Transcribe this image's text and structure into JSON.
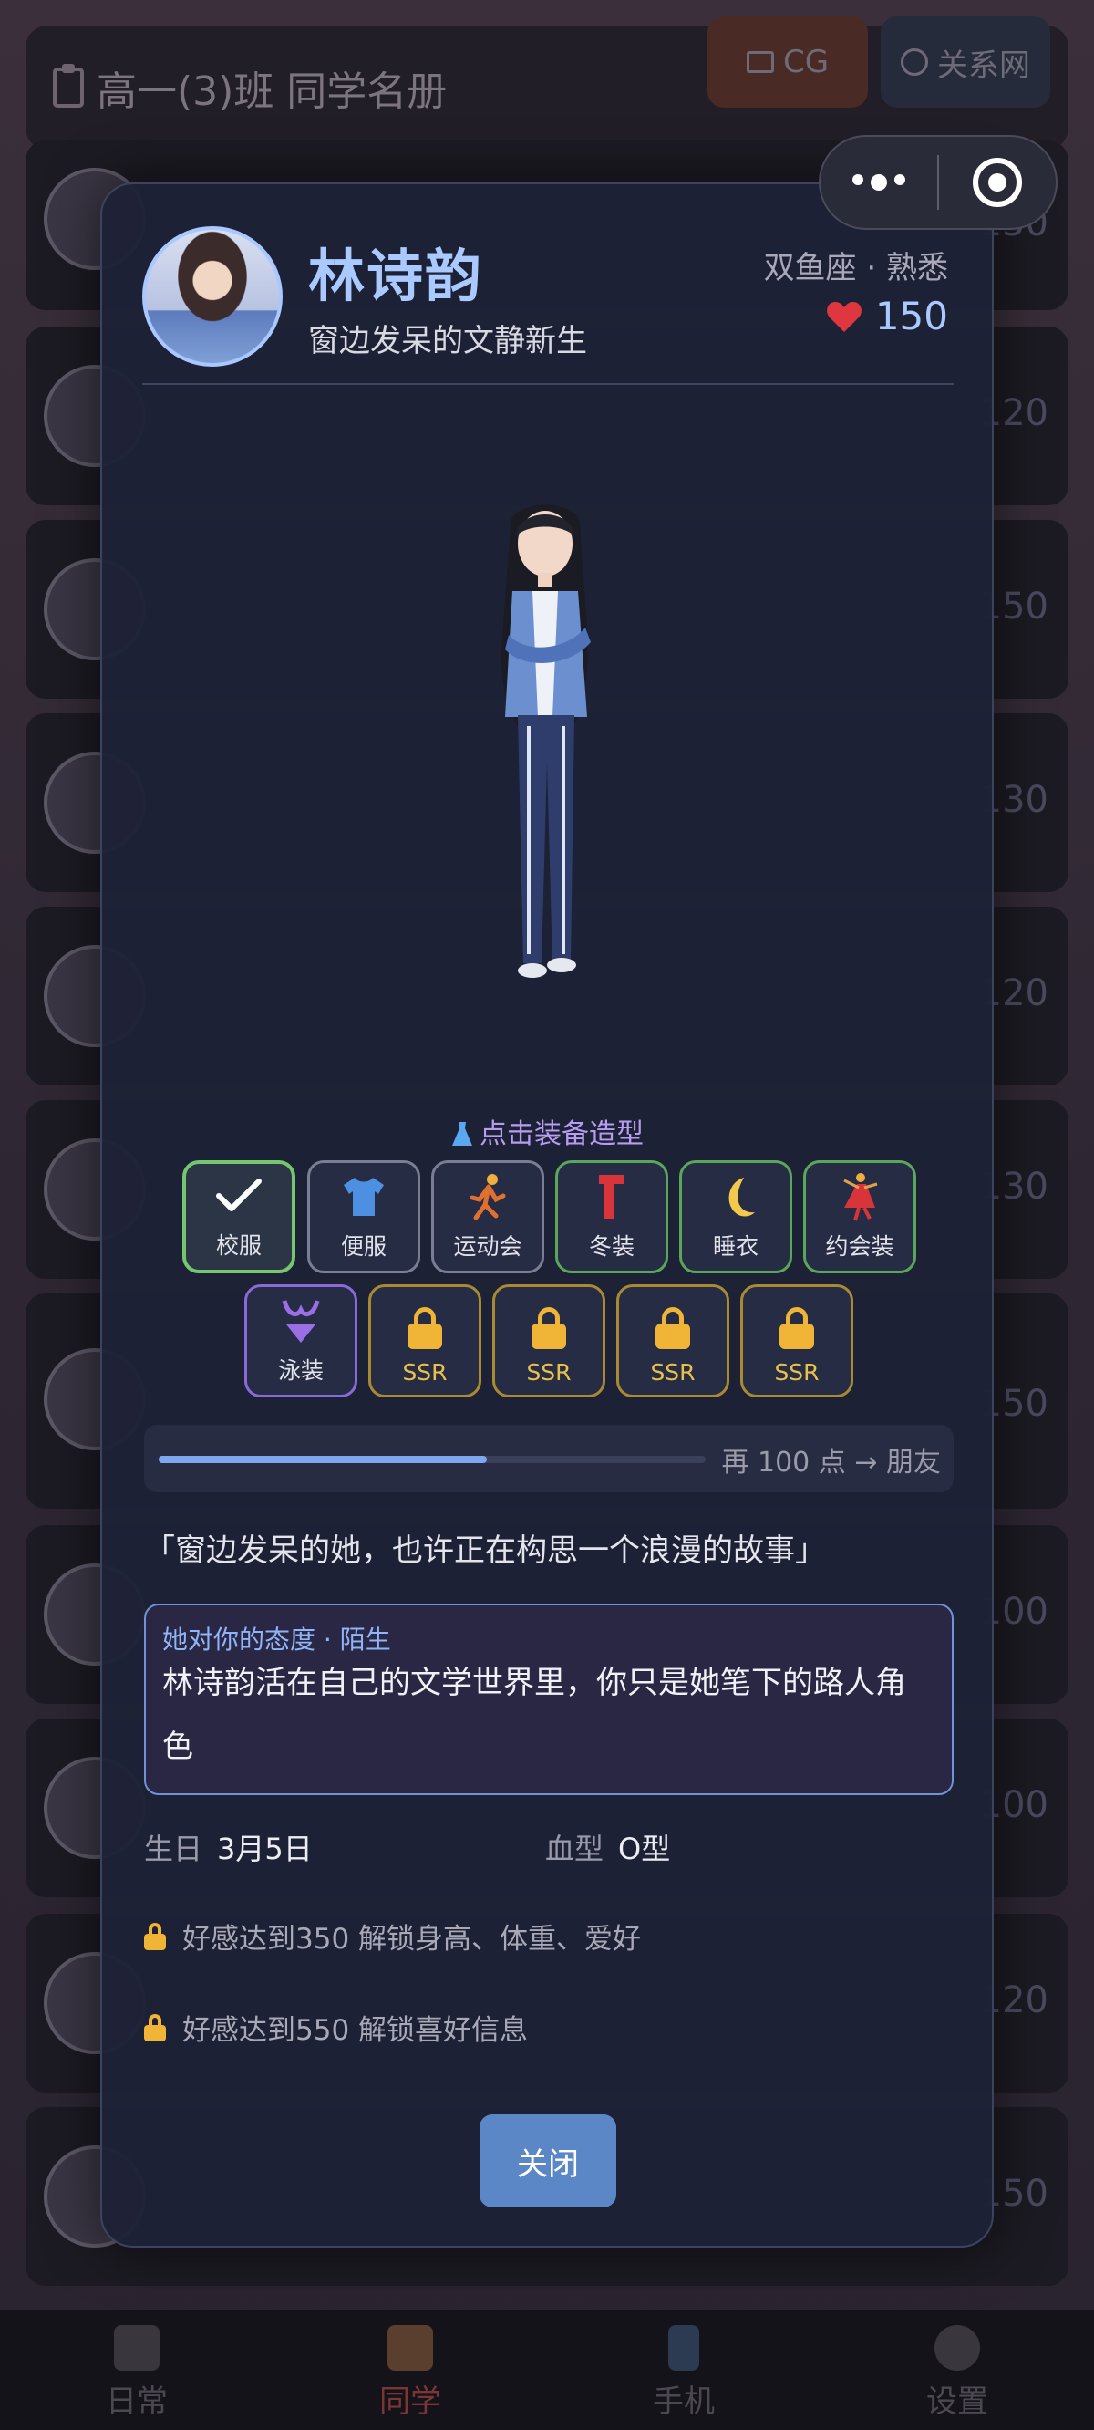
{
  "background": {
    "header_title": "高一(3)班 同学名册",
    "cg_button": "CG",
    "relation_button": "关系网",
    "card_numbers": [
      "150",
      "120",
      "150",
      "130",
      "120",
      "130",
      "150",
      "100",
      "100",
      "120",
      "150"
    ],
    "tabs": [
      "日常",
      "同学",
      "手机",
      "设置"
    ],
    "active_tab": "同学"
  },
  "profile": {
    "name": "林诗韵",
    "subtitle": "窗边发呆的文静新生",
    "meta": "双鱼座 · 熟悉",
    "affection": "150"
  },
  "outfits": {
    "title": "点击装备造型",
    "row1": [
      {
        "label": "校服",
        "state": "selected",
        "icon": "check-icon"
      },
      {
        "label": "便服",
        "state": "available",
        "icon": "tshirt-icon"
      },
      {
        "label": "运动会",
        "state": "available",
        "icon": "runner-icon"
      },
      {
        "label": "冬装",
        "state": "available",
        "icon": "scarf-icon"
      },
      {
        "label": "睡衣",
        "state": "available",
        "icon": "moon-icon"
      },
      {
        "label": "约会装",
        "state": "available",
        "icon": "dancer-icon"
      }
    ],
    "row2": [
      {
        "label": "泳装",
        "state": "available",
        "icon": "bikini-icon"
      },
      {
        "label": "SSR",
        "state": "locked",
        "icon": "lock-icon"
      },
      {
        "label": "SSR",
        "state": "locked",
        "icon": "lock-icon"
      },
      {
        "label": "SSR",
        "state": "locked",
        "icon": "lock-icon"
      },
      {
        "label": "SSR",
        "state": "locked",
        "icon": "lock-icon"
      }
    ]
  },
  "progress": {
    "fraction": 0.6,
    "text": "再 100 点 → 朋友"
  },
  "quote": "「窗边发呆的她，也许正在构思一个浪漫的故事」",
  "attitude": {
    "header": "她对你的态度 · 陌生",
    "body": "林诗韵活在自己的文学世界里，你只是她笔下的路人角色"
  },
  "info": {
    "birthday_label": "生日",
    "birthday_value": "3月5日",
    "blood_label": "血型",
    "blood_value": "O型"
  },
  "unlocks": [
    "好感达到350 解锁身高、体重、爱好",
    "好感达到550 解锁喜好信息"
  ],
  "close_button": "关闭",
  "colors": {
    "accent_blue": "#a9c9ff",
    "selected_green": "#76c66f",
    "ssr_gold": "#e9c04a",
    "swimsuit_purple": "#8a6ad8",
    "heart_red": "#e0363f"
  }
}
